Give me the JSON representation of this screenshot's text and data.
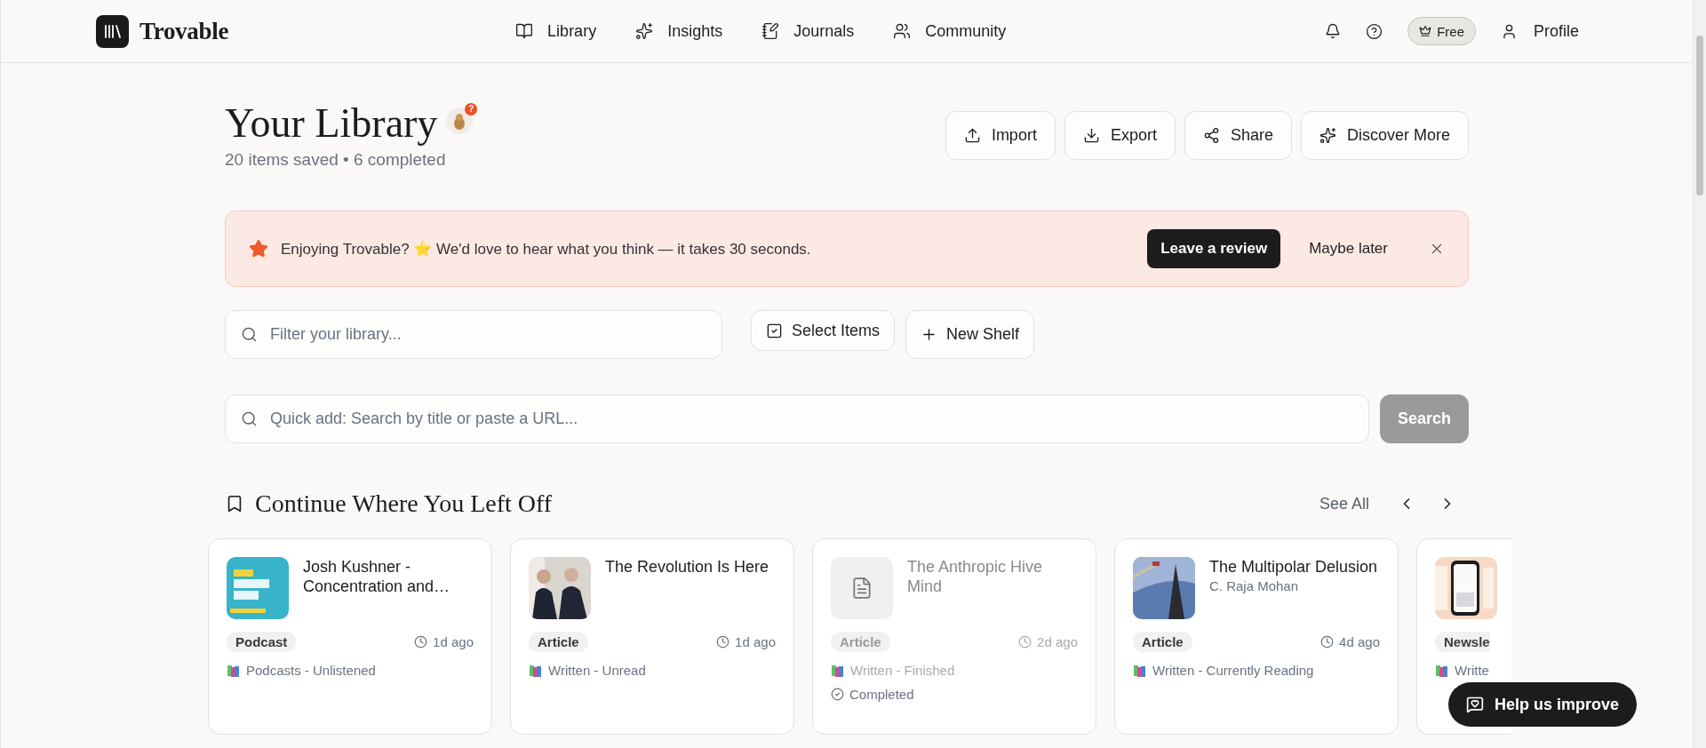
{
  "app": {
    "name": "Trovable"
  },
  "nav": [
    {
      "label": "Library"
    },
    {
      "label": "Insights"
    },
    {
      "label": "Journals"
    },
    {
      "label": "Community"
    }
  ],
  "account": {
    "plan": "Free",
    "profile": "Profile"
  },
  "page": {
    "title": "Your Library",
    "badge": "?",
    "subtitle": "20 items saved • 6 completed"
  },
  "actions": [
    {
      "label": "Import"
    },
    {
      "label": "Export"
    },
    {
      "label": "Share"
    },
    {
      "label": "Discover More"
    }
  ],
  "banner": {
    "message": "Enjoying Trovable? ⭐ We'd love to hear what you think — it takes 30 seconds.",
    "primary": "Leave a review",
    "secondary": "Maybe later"
  },
  "filter": {
    "placeholder": "Filter your library..."
  },
  "tools": [
    {
      "label": "Select Items"
    },
    {
      "label": "New Shelf"
    }
  ],
  "quick_add": {
    "placeholder": "Quick add: Search by title or paste a URL...",
    "button": "Search",
    "disabled": true
  },
  "section": {
    "title": "Continue Where You Left Off",
    "see_all": "See All"
  },
  "cards": [
    {
      "kind": "card",
      "title": "Josh Kushner - Concentration and…",
      "type": "Podcast",
      "time": "1d ago",
      "shelf": "Podcasts - Unlistened",
      "completed": false
    },
    {
      "kind": "card",
      "title": "The Revolution Is Here",
      "type": "Article",
      "time": "1d ago",
      "shelf": "Written - Unread",
      "completed": false
    },
    {
      "kind": "card",
      "title": "The Anthropic Hive Mind",
      "type": "Article",
      "time": "2d ago",
      "shelf": "Written - Finished",
      "thumb": {
        "kind": "document"
      },
      "completed": true,
      "completed_label": "Completed"
    },
    {
      "kind": "card",
      "title": "The Multipolar Delusion",
      "author": "C. Raja Mohan",
      "type": "Article",
      "time": "4d ago",
      "shelf": "Written - Currently Reading",
      "completed": false
    },
    {
      "kind": "partial",
      "type": "Newsle",
      "shelf": "Writte",
      "completed": false
    }
  ],
  "help": {
    "label": "Help us improve"
  }
}
